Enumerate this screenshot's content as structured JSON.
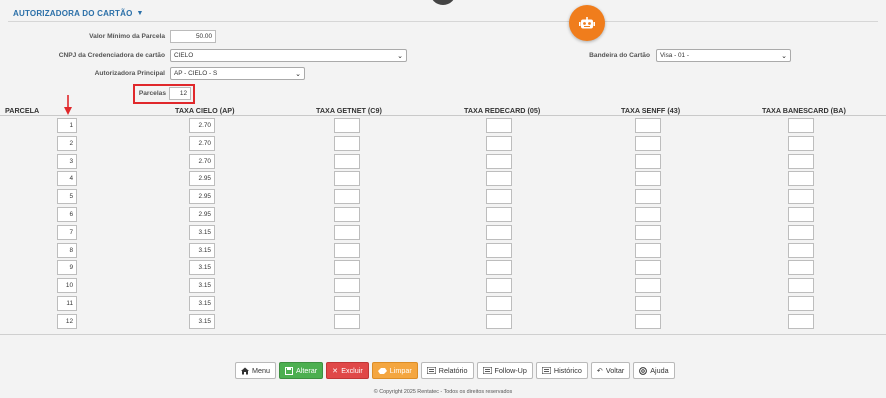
{
  "section": {
    "title": "AUTORIZADORA DO CARTÃO"
  },
  "form": {
    "valor_minimo_label": "Valor Mínimo da Parcela",
    "valor_minimo_value": "50.00",
    "cnpj_label": "CNPJ da Credenciadora de cartão",
    "cnpj_value": "CIELO",
    "autorizadora_label": "Autorizadora Principal",
    "autorizadora_value": "AP - CIELO - S",
    "parcelas_label": "Parcelas",
    "parcelas_value": "12",
    "bandeira_label": "Bandeira do Cartão",
    "bandeira_value": "Visa - 01 -"
  },
  "grid": {
    "headers": {
      "parcela": "PARCELA",
      "cielo": "TAXA CIELO (AP)",
      "getnet": "TAXA GETNET (C9)",
      "redecard": "TAXA REDECARD (05)",
      "senff": "TAXA SENFF (43)",
      "banescard": "TAXA BANESCARD (BA)"
    },
    "rows": [
      {
        "parcela": "1",
        "cielo": "2.70",
        "getnet": "",
        "redecard": "",
        "senff": "",
        "banescard": ""
      },
      {
        "parcela": "2",
        "cielo": "2.70",
        "getnet": "",
        "redecard": "",
        "senff": "",
        "banescard": ""
      },
      {
        "parcela": "3",
        "cielo": "2.70",
        "getnet": "",
        "redecard": "",
        "senff": "",
        "banescard": ""
      },
      {
        "parcela": "4",
        "cielo": "2.95",
        "getnet": "",
        "redecard": "",
        "senff": "",
        "banescard": ""
      },
      {
        "parcela": "5",
        "cielo": "2.95",
        "getnet": "",
        "redecard": "",
        "senff": "",
        "banescard": ""
      },
      {
        "parcela": "6",
        "cielo": "2.95",
        "getnet": "",
        "redecard": "",
        "senff": "",
        "banescard": ""
      },
      {
        "parcela": "7",
        "cielo": "3.15",
        "getnet": "",
        "redecard": "",
        "senff": "",
        "banescard": ""
      },
      {
        "parcela": "8",
        "cielo": "3.15",
        "getnet": "",
        "redecard": "",
        "senff": "",
        "banescard": ""
      },
      {
        "parcela": "9",
        "cielo": "3.15",
        "getnet": "",
        "redecard": "",
        "senff": "",
        "banescard": ""
      },
      {
        "parcela": "10",
        "cielo": "3.15",
        "getnet": "",
        "redecard": "",
        "senff": "",
        "banescard": ""
      },
      {
        "parcela": "11",
        "cielo": "3.15",
        "getnet": "",
        "redecard": "",
        "senff": "",
        "banescard": ""
      },
      {
        "parcela": "12",
        "cielo": "3.15",
        "getnet": "",
        "redecard": "",
        "senff": "",
        "banescard": ""
      }
    ]
  },
  "toolbar": {
    "menu": "Menu",
    "alterar": "Alterar",
    "excluir": "Excluir",
    "limpar": "Limpar",
    "relatorio": "Relatório",
    "followup": "Follow-Up",
    "historico": "Histórico",
    "voltar": "Voltar",
    "ajuda": "Ajuda"
  },
  "colors": {
    "accent_blue": "#2a6fa8",
    "robot_orange": "#f07d1c",
    "highlight_red": "#e0282b",
    "alterar_green": "#4caf50",
    "excluir_red": "#e04848",
    "limpar_orange": "#f4a640"
  },
  "icons": {
    "robot": "robot-icon",
    "menu": "home-icon",
    "alterar": "save-icon",
    "excluir": "x-icon",
    "limpar": "eraser-icon",
    "relatorio": "list-icon",
    "followup": "list-icon",
    "historico": "list-icon",
    "voltar": "undo-icon",
    "ajuda": "help-circle-icon"
  },
  "footer": {
    "copyright": "© Copyright 2025 Rentatec - Todos os direitos reservados"
  }
}
